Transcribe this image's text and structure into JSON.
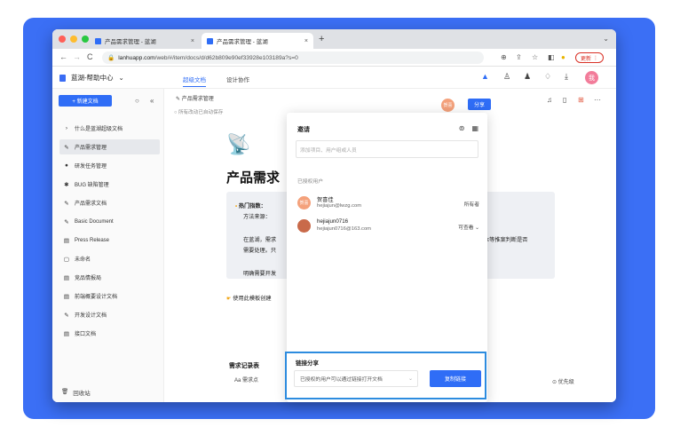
{
  "browser": {
    "tabs": [
      {
        "title": "产品需求管理 - 蓝湖"
      },
      {
        "title": "产品需求管理 - 蓝湖"
      }
    ],
    "url_prefix": "lanhuapp.com",
    "url_rest": "/web/#/item/docs/d/d62b809e90ef33928e103189a?s=0",
    "update_label": "更新",
    "colors": {
      "close": "#ff5f57",
      "min": "#febc2e",
      "max": "#28c840"
    }
  },
  "topbar": {
    "brand": "蓝湖-帮助中心",
    "tabs": [
      "超级文档",
      "设计协作"
    ],
    "avatar": "我"
  },
  "sidebar": {
    "new_doc": "+ 新建文档",
    "items": [
      {
        "icon": "›",
        "label": "什么是蓝湖超级文档"
      },
      {
        "icon": "✎",
        "label": "产品需求管理"
      },
      {
        "icon": "●",
        "label": "研发任务管理"
      },
      {
        "icon": "✱",
        "label": "BUG 缺陷管理"
      },
      {
        "icon": "✎",
        "label": "产品需求文档"
      },
      {
        "icon": "✎",
        "label": "Basic Document"
      },
      {
        "icon": "▤",
        "label": "Press Release"
      },
      {
        "icon": "▢",
        "label": "未命名"
      },
      {
        "icon": "▤",
        "label": "竞品情报局"
      },
      {
        "icon": "▤",
        "label": "前端概要设计文档"
      },
      {
        "icon": "✎",
        "label": "开发设计文档"
      },
      {
        "icon": "▤",
        "label": "接口文档"
      }
    ],
    "trash": "回收站"
  },
  "doc": {
    "breadcrumb": "产品需求管理",
    "autosave": "所有改动已自动保存",
    "title": "产品需求",
    "callout": {
      "line1": "热门指数：",
      "line2": "方法来源：",
      "line3": "在蓝湖，需求",
      "line3_right": "本等推案判断是否",
      "line4": "需要处理。只",
      "line5": "明确需要开发"
    },
    "template_tip": "使用此模板创建",
    "req_header": "需求记录表",
    "req_col": "Aa 需求点",
    "priority_col": "优先级"
  },
  "share_button": "分享",
  "owner_chip": "贺喜",
  "invite_panel": {
    "title": "邀请",
    "placeholder": "添加项目、用户组或人员",
    "section": "已授权用户",
    "users": [
      {
        "name": "贺喜佳",
        "email": "hejiajun@lwzg.com",
        "role": "所有者",
        "avatar": "贺喜",
        "color": "#f4a17b"
      },
      {
        "name": "hejiajun0716",
        "email": "hejiajun0716@163.com",
        "role": "可查看 ⌄",
        "avatar": "",
        "color": "#c96a4a"
      }
    ]
  },
  "link_share": {
    "title": "链接分享",
    "select": "已授权的用户可以通过链接打开文档",
    "button": "复制链接"
  }
}
